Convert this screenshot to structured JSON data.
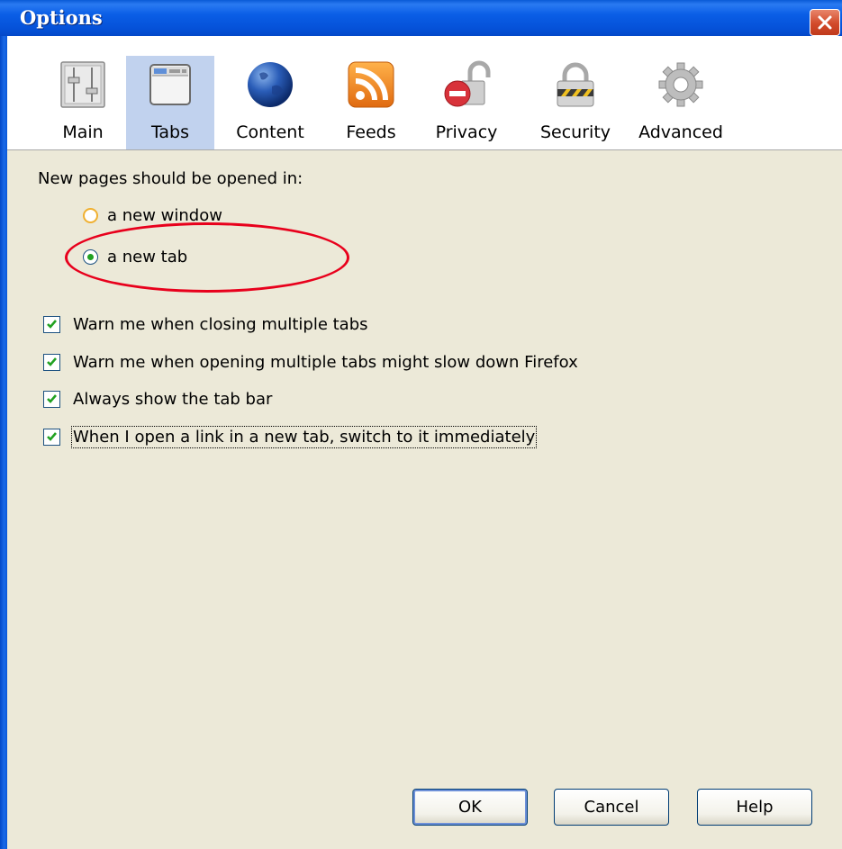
{
  "window": {
    "title": "Options"
  },
  "toolbar": {
    "panes": [
      {
        "label": "Main",
        "icon": "main-sliders-icon"
      },
      {
        "label": "Tabs",
        "icon": "tabs-window-icon"
      },
      {
        "label": "Content",
        "icon": "globe-icon"
      },
      {
        "label": "Feeds",
        "icon": "rss-feed-icon"
      },
      {
        "label": "Privacy",
        "icon": "privacy-lock-icon"
      },
      {
        "label": "Security",
        "icon": "security-padlock-icon"
      },
      {
        "label": "Advanced",
        "icon": "gear-icon"
      }
    ],
    "selected": "Tabs"
  },
  "tabs_pane": {
    "open_in_label": "New pages should be opened in:",
    "options": [
      {
        "label": "a new window",
        "selected": false
      },
      {
        "label": "a new tab",
        "selected": true
      }
    ],
    "checkboxes": [
      {
        "label": "Warn me when closing multiple tabs",
        "checked": true
      },
      {
        "label": "Warn me when opening multiple tabs might slow down Firefox",
        "checked": true
      },
      {
        "label": "Always show the tab bar",
        "checked": true
      },
      {
        "label": "When I open a link in a new tab, switch to it immediately",
        "checked": true
      }
    ]
  },
  "buttons": {
    "ok": "OK",
    "cancel": "Cancel",
    "help": "Help"
  },
  "colors": {
    "titlebar": "#0a5ee6",
    "dialog_bg": "#ece9d8",
    "selected_pane": "#c1d2ee",
    "annotation": "#e8001c",
    "check_mark": "#21a121"
  }
}
